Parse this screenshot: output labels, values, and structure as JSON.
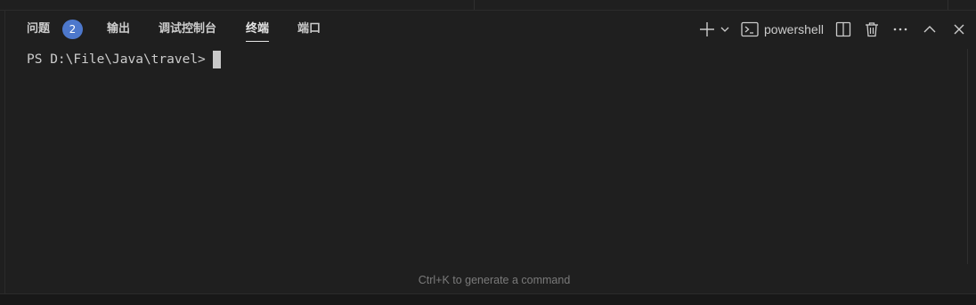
{
  "panel": {
    "tabs": [
      {
        "label": "问题",
        "badge": "2",
        "active": false
      },
      {
        "label": "输出",
        "active": false
      },
      {
        "label": "调试控制台",
        "active": false
      },
      {
        "label": "终端",
        "active": true
      },
      {
        "label": "端口",
        "active": false
      }
    ],
    "toolbar": {
      "new_terminal_icon": "plus-icon",
      "dropdown_icon": "chevron-down-icon",
      "shell_icon": "terminal-icon",
      "shell_label": "powershell",
      "split_icon": "split-editor-icon",
      "kill_icon": "trash-icon",
      "more_icon": "ellipsis-icon",
      "maximize_icon": "chevron-up-icon",
      "close_icon": "close-icon"
    }
  },
  "terminal": {
    "prompt": "PS D:\\File\\Java\\travel>"
  },
  "hint": {
    "text": "Ctrl+K to generate a command"
  },
  "colors": {
    "background": "#1f1f1f",
    "badge": "#4d78cc",
    "text": "#cccccc",
    "hint": "#7a7a7a"
  }
}
